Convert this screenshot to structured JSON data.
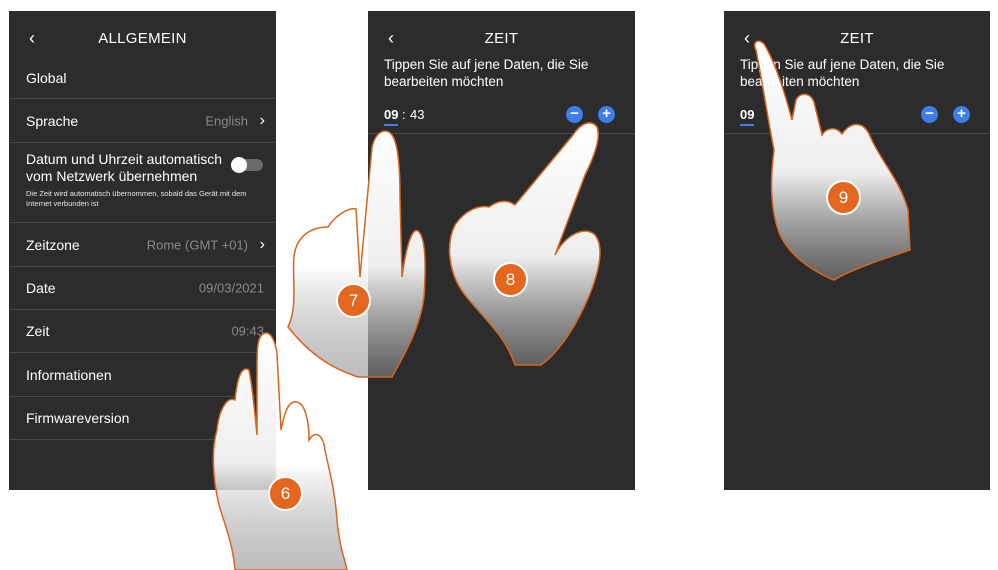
{
  "screen1": {
    "back_icon": "‹",
    "title": "ALLGEMEIN",
    "section": "Global",
    "rows": [
      {
        "label": "Sprache",
        "value": "English"
      },
      {
        "label": "Zeitzone",
        "value": "Rome (GMT +01)"
      },
      {
        "label": "Date",
        "value": "09/03/2021"
      },
      {
        "label": "Zeit",
        "value": "09:43"
      },
      {
        "label": "Informationen"
      },
      {
        "label": "Firmwareversion"
      }
    ],
    "auto_label": "Datum und Uhrzeit automatisch vom Netzwerk übernehmen",
    "auto_note": "Die Zeit wird automatisch übernommen, sobald das Gerät mit dem Internet verbunden ist",
    "auto_enabled": false
  },
  "screen2": {
    "back_icon": "‹",
    "title": "ZEIT",
    "instruction": "Tippen Sie auf jene Daten, die Sie bearbeiten möchten",
    "hour": "09",
    "separator": ":",
    "minute": "43",
    "minus": "−",
    "plus": "+"
  },
  "screen3": {
    "back_icon": "‹",
    "title": "ZEIT",
    "instruction": "Tippen Sie auf jene Daten, die Sie bearbeiten möchten",
    "hour": "09",
    "minus": "−",
    "plus": "+"
  },
  "steps": [
    "6",
    "7",
    "8",
    "9"
  ],
  "colors": {
    "screen_bg": "#2c2c2c",
    "accent_blue": "#3d7ee8",
    "step_orange": "#e3671e",
    "hand_outline": "#d9641e"
  },
  "icons": [
    "chevron-left-icon",
    "chevron-right-icon",
    "minus-circle-icon",
    "plus-circle-icon",
    "toggle-switch",
    "pointing-hand"
  ]
}
